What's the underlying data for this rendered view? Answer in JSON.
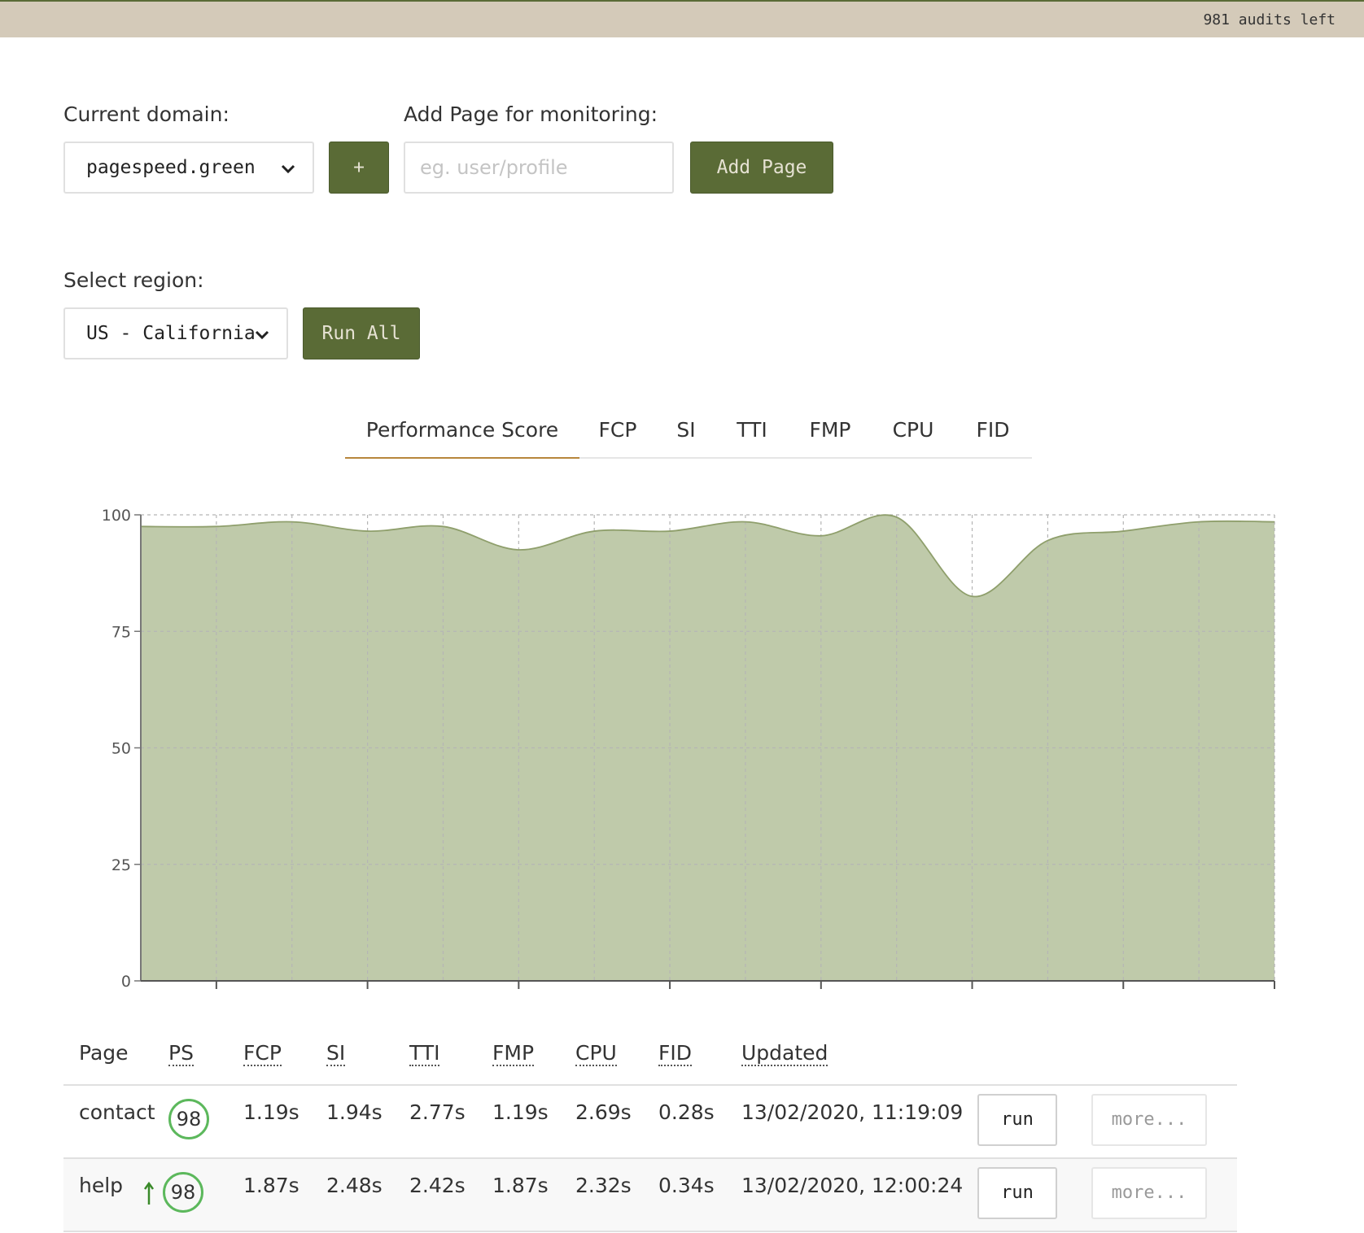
{
  "header": {
    "audits_left": "981 audits left"
  },
  "domain": {
    "label": "Current domain:",
    "selected": "pagespeed.green",
    "add_domain_label": "+"
  },
  "add_page": {
    "label": "Add Page for monitoring:",
    "placeholder": "eg. user/profile",
    "value": "",
    "button": "Add Page"
  },
  "region": {
    "label": "Select region:",
    "selected": "US - California",
    "run_all": "Run All"
  },
  "tabs": [
    "Performance Score",
    "FCP",
    "SI",
    "TTI",
    "FMP",
    "CPU",
    "FID"
  ],
  "active_tab": "Performance Score",
  "colors": {
    "brand": "#5a6b36",
    "area_fill": "#bfcaaa",
    "area_stroke": "#8f9f6c",
    "good_badge": "#5cb85c",
    "active_tab_underline": "#b7863c",
    "topbar": "#d4cab9"
  },
  "chart_data": {
    "type": "area",
    "title": "",
    "xlabel": "",
    "ylabel": "",
    "ylim": [
      0,
      100
    ],
    "yticks": [
      "0",
      "25",
      "50",
      "75",
      "100"
    ],
    "grid": true,
    "legend": "none",
    "x": [
      0,
      0.5,
      1,
      1.5,
      2,
      2.5,
      3,
      3.5,
      4,
      4.5,
      5,
      5.5,
      6,
      6.5,
      7,
      7.5
    ],
    "series": [
      {
        "values": [
          97.5,
          97.5,
          98.5,
          96.5,
          97.5,
          92.5,
          96.5,
          96.5,
          98.5,
          95.5,
          99.5,
          82.5,
          94.5,
          96.5,
          98.5,
          98.5
        ]
      }
    ]
  },
  "table": {
    "columns": [
      "Page",
      "PS",
      "FCP",
      "SI",
      "TTI",
      "FMP",
      "CPU",
      "FID",
      "Updated"
    ],
    "run_label": "run",
    "more_label": "more...",
    "rows": [
      {
        "page": "contact",
        "trend": "",
        "ps": "98",
        "fcp": "1.19s",
        "si": "1.94s",
        "tti": "2.77s",
        "fmp": "1.19s",
        "cpu": "2.69s",
        "fid": "0.28s",
        "updated": "13/02/2020, 11:19:09"
      },
      {
        "page": "help",
        "trend": "up",
        "ps": "98",
        "fcp": "1.87s",
        "si": "2.48s",
        "tti": "2.42s",
        "fmp": "1.87s",
        "cpu": "2.32s",
        "fid": "0.34s",
        "updated": "13/02/2020, 12:00:24"
      }
    ]
  }
}
